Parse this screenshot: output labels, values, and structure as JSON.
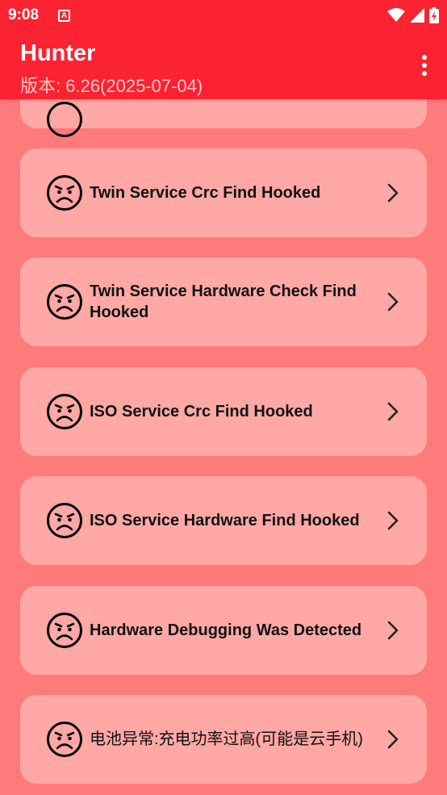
{
  "status_bar": {
    "time": "9:08",
    "notification_letter": "A"
  },
  "app_bar": {
    "title": "Hunter",
    "subtitle": "版本: 6.26(2025-07-04)"
  },
  "items": [
    {
      "label": ""
    },
    {
      "label": "Twin Service Crc Find Hooked"
    },
    {
      "label": "Twin Service Hardware Check Find Hooked"
    },
    {
      "label": "ISO Service Crc Find Hooked"
    },
    {
      "label": "ISO Service Hardware Find Hooked"
    },
    {
      "label": "Hardware Debugging Was Detected"
    },
    {
      "label": "电池异常:充电功率过高(可能是云手机)"
    }
  ],
  "colors": {
    "primary": "#fb2231",
    "background": "#ff7a7a",
    "card": "#ffa8a5"
  },
  "icons": {
    "item_icon": "sad-face-icon",
    "item_action": "chevron-right-icon",
    "menu": "overflow-menu-icon"
  }
}
